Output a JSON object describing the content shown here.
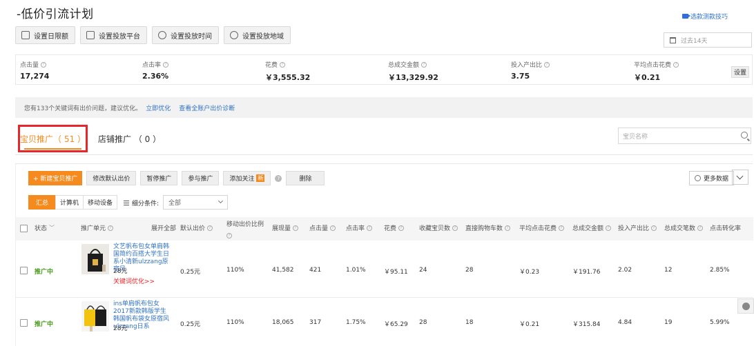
{
  "page": {
    "title": "-低价引流计划",
    "help_link": "选款测款技巧",
    "date_range": "过去14天"
  },
  "settings_buttons": [
    {
      "label": "设置日限额",
      "icon": "calendar-grid-icon"
    },
    {
      "label": "设置投放平台",
      "icon": "monitor-icon"
    },
    {
      "label": "设置投放时间",
      "icon": "clock-icon"
    },
    {
      "label": "设置投放地域",
      "icon": "location-icon"
    }
  ],
  "metrics": [
    {
      "label": "点击量",
      "value": "17,274"
    },
    {
      "label": "点击率",
      "value": "2.36%"
    },
    {
      "label": "花费",
      "value": "￥3,555.32"
    },
    {
      "label": "总成交金额",
      "value": "￥13,329.92"
    },
    {
      "label": "投入产出比",
      "value": "3.75"
    },
    {
      "label": "平均点击花费",
      "value": "￥0.21"
    }
  ],
  "metrics_setting": "设置",
  "notice": {
    "text": "您有133个关键词有出价问题，建议优化。",
    "link1": "立即优化",
    "link2": "查看全账户出价诊断"
  },
  "tabs": {
    "active": "宝贝推广（ 51 ）",
    "other": "店铺推广 （ 0 ）"
  },
  "search": {
    "placeholder": "宝贝名称"
  },
  "toolbar": {
    "new_promo": "+ 新建宝贝推广",
    "edit_bid": "修改默认出价",
    "pause": "暂停推广",
    "join": "参与推广",
    "follow": "添加关注",
    "follow_badge": "新",
    "delete": "删除",
    "more_data": "更多数据"
  },
  "segments": [
    "汇总",
    "计算机",
    "移动设备"
  ],
  "filter": {
    "label": "细分条件:",
    "value": "全部"
  },
  "columns": {
    "status": "状态",
    "unit": "推广单元",
    "expand_all": "展开全部",
    "default_bid": "默认出价",
    "mobile_ratio": "移动出价比例",
    "impressions": "展现量",
    "clicks": "点击量",
    "ctr": "点击率",
    "cost": "花费",
    "fav_items": "收藏宝贝数",
    "cart_adds": "直接购物车数",
    "avg_cpc": "平均点击花费",
    "total_sales": "总成交金额",
    "roi": "投入产出比",
    "total_orders": "总成交笔数",
    "cvr": "点击转化率"
  },
  "rows": [
    {
      "status": "推广中",
      "title": "文艺帆布包女单肩韩国简约百搭大学生日系小清新ulzzang原宿风",
      "price": "28元",
      "optimize": "关键词优化>>",
      "default_bid": "0.25元",
      "mobile_ratio": "110%",
      "impressions": "41,582",
      "clicks": "421",
      "ctr": "1.01%",
      "cost": "￥95.11",
      "fav_items": "24",
      "cart_adds": "28",
      "avg_cpc": "￥0.23",
      "total_sales": "￥191.76",
      "roi": "2.02",
      "total_orders": "12",
      "cvr": "2.85%"
    },
    {
      "status": "推广中",
      "title": "ins单肩帆布包女2017新款韩版学生韩国帆布袋女原宿风ulzzang日系",
      "price": "28元",
      "default_bid": "0.25元",
      "mobile_ratio": "110%",
      "impressions": "18,065",
      "clicks": "317",
      "ctr": "1.75%",
      "cost": "￥65.29",
      "fav_items": "28",
      "cart_adds": "18",
      "avg_cpc": "￥0.21",
      "total_sales": "￥315.84",
      "roi": "4.84",
      "total_orders": "19",
      "cvr": "5.99%"
    }
  ]
}
